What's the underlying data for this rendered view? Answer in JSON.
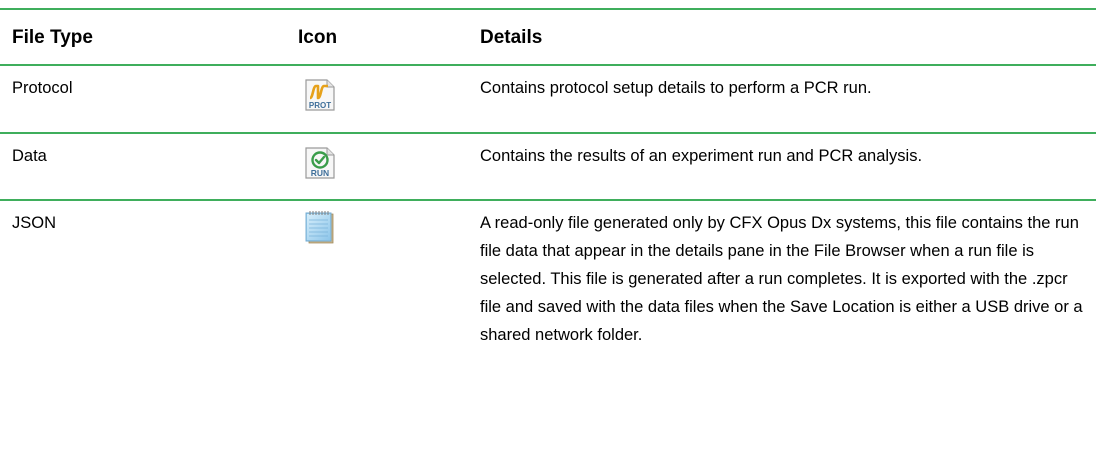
{
  "table": {
    "headers": {
      "file_type": "File Type",
      "icon": "Icon",
      "details": "Details"
    },
    "rows": [
      {
        "file_type": "Protocol",
        "icon": "protocol-file-icon",
        "icon_text": "PROT",
        "details": "Contains protocol setup details to perform a PCR run."
      },
      {
        "file_type": "Data",
        "icon": "run-data-file-icon",
        "icon_text": "RUN",
        "details": "Contains the results of an experiment run and PCR analysis."
      },
      {
        "file_type": "JSON",
        "icon": "notepad-file-icon",
        "details": "A read-only file generated only by CFX Opus Dx systems, this file contains the run file data that appear in the details pane in the File Browser when a run file is selected. This file is generated after a run completes. It is exported with the .zpcr file and saved with the data files when the Save Location is either a USB drive or a shared network folder."
      }
    ]
  },
  "colors": {
    "rule": "#3fae5c",
    "prot_wave": "#e6a11a",
    "run_check": "#3a9d4a",
    "icon_text": "#3f6f9a"
  }
}
